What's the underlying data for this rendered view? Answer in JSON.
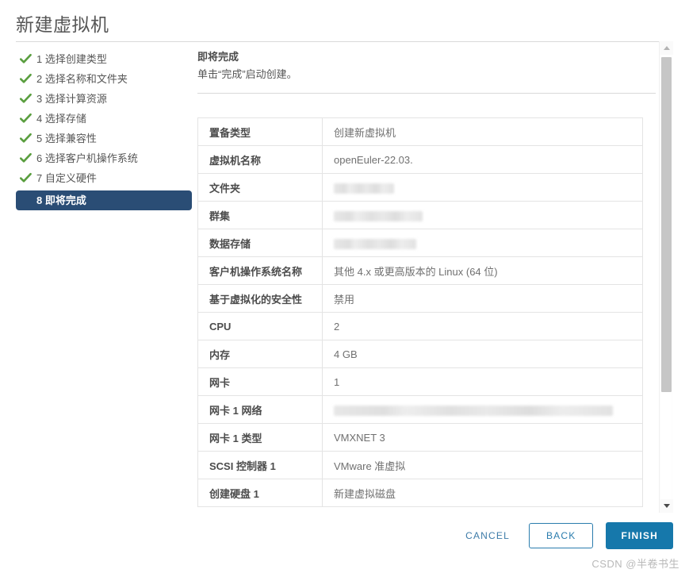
{
  "window": {
    "title": "新建虚拟机"
  },
  "steps": [
    {
      "num": "1",
      "label": "1 选择创建类型",
      "state": "done"
    },
    {
      "num": "2",
      "label": "2 选择名称和文件夹",
      "state": "done"
    },
    {
      "num": "3",
      "label": "3 选择计算资源",
      "state": "done"
    },
    {
      "num": "4",
      "label": "4 选择存储",
      "state": "done"
    },
    {
      "num": "5",
      "label": "5 选择兼容性",
      "state": "done"
    },
    {
      "num": "6",
      "label": "6 选择客户机操作系统",
      "state": "done"
    },
    {
      "num": "7",
      "label": "7 自定义硬件",
      "state": "done"
    },
    {
      "num": "8",
      "label": "8 即将完成",
      "state": "current"
    }
  ],
  "content": {
    "heading": "即将完成",
    "subtitle": "单击“完成”启动创建。"
  },
  "summary": {
    "rows": [
      {
        "key": "置备类型",
        "value": "创建新虚拟机",
        "redacted": false
      },
      {
        "key": "虚拟机名称",
        "value": "openEuler-22.03.",
        "redacted": false
      },
      {
        "key": "文件夹",
        "value": "",
        "redacted": true,
        "redact_width": "w-short"
      },
      {
        "key": "群集",
        "value": "",
        "redacted": true,
        "redact_width": "w-medium"
      },
      {
        "key": "数据存储",
        "value": "",
        "redacted": true,
        "redact_width": "w-medium2"
      },
      {
        "key": "客户机操作系统名称",
        "value": "其他 4.x 或更高版本的 Linux (64 位)",
        "redacted": false
      },
      {
        "key": "基于虚拟化的安全性",
        "value": "禁用",
        "redacted": false
      },
      {
        "key": "CPU",
        "value": "2",
        "redacted": false
      },
      {
        "key": "内存",
        "value": "4 GB",
        "redacted": false
      },
      {
        "key": "网卡",
        "value": "1",
        "redacted": false
      },
      {
        "key": "网卡 1 网络",
        "value": "",
        "redacted": true,
        "redact_width": "w-long"
      },
      {
        "key": "网卡 1 类型",
        "value": "VMXNET 3",
        "redacted": false
      },
      {
        "key": "SCSI 控制器 1",
        "value": "VMware 准虚拟",
        "redacted": false
      },
      {
        "key": "创建硬盘 1",
        "value": "新建虚拟磁盘",
        "redacted": false
      }
    ]
  },
  "footer": {
    "cancel_label": "CANCEL",
    "back_label": "BACK",
    "finish_label": "FINISH"
  },
  "watermark": {
    "text": "CSDN @半卷书生"
  },
  "colors": {
    "current_step_bg": "#2a4d75",
    "check_green": "#5a9e3f",
    "primary_button": "#1678ab",
    "outline_button_border": "#2a7cad",
    "link_text": "#3d7ba8"
  }
}
